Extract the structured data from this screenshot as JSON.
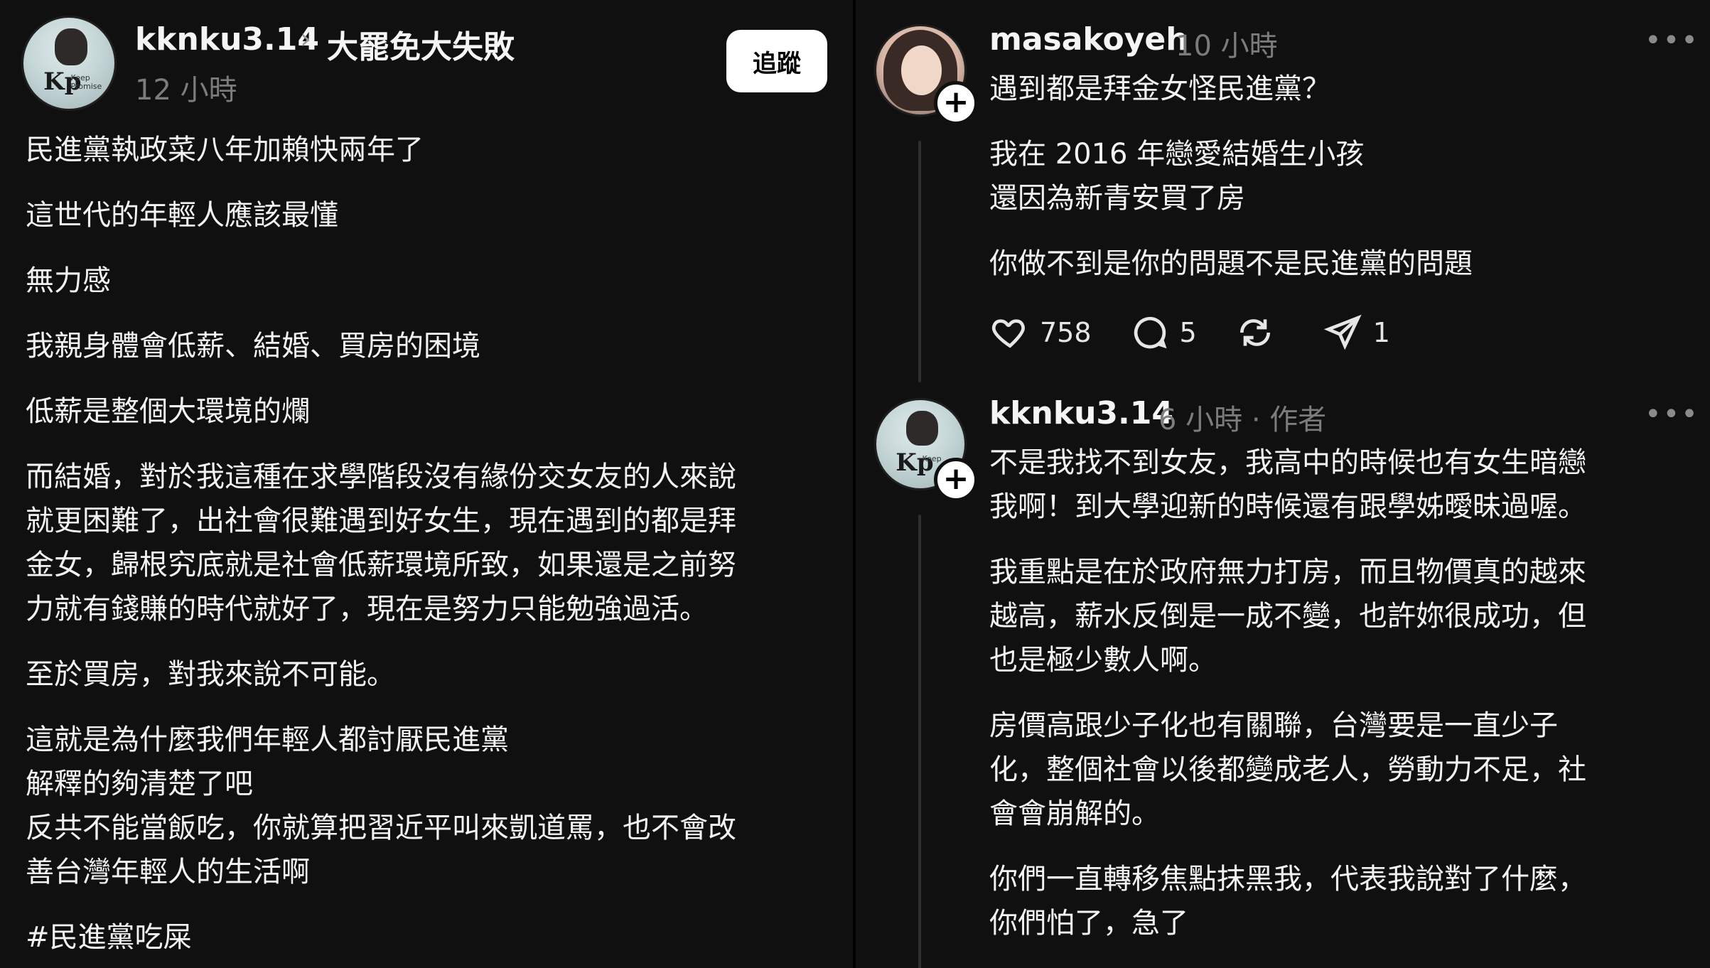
{
  "left_post": {
    "username": "kknku3.14",
    "separator": "›",
    "topic": "大罷免大失敗",
    "time": "12 小時",
    "follow_label": "追蹤",
    "avatar_logo": "Kp",
    "avatar_logo_sub": "Keep Promise",
    "paragraphs": [
      [
        "民進黨執政菜八年加賴快兩年了"
      ],
      [
        "這世代的年輕人應該最懂"
      ],
      [
        "無力感"
      ],
      [
        "我親身體會低薪、結婚、買房的困境"
      ],
      [
        "低薪是整個大環境的爛"
      ],
      [
        "而結婚，對於我這種在求學階段沒有緣份交女友的人來說",
        "就更困難了，出社會很難遇到好女生，現在遇到的都是拜",
        "金女，歸根究底就是社會低薪環境所致，如果還是之前努",
        "力就有錢賺的時代就好了，現在是努力只能勉強過活。"
      ],
      [
        "至於買房，對我來說不可能。"
      ],
      [
        "這就是為什麼我們年輕人都討厭民進黨",
        "解釋的夠清楚了吧",
        "反共不能當飯吃，你就算把習近平叫來凱道罵，也不會改",
        "善台灣年輕人的生活啊"
      ],
      [
        "#民進黨吃屎"
      ]
    ]
  },
  "reply1": {
    "username": "masakoyeh",
    "time": "10 小時",
    "more": "•••",
    "lines": [
      "遇到都是拜金女怪民進黨？",
      "我在 2016 年戀愛結婚生小孩",
      "還因為新青安買了房",
      "你做不到是你的問題不是民進黨的問題"
    ],
    "likes": "758",
    "comments": "5",
    "shares": "1",
    "icons": [
      "heart-icon",
      "comment-icon",
      "repost-icon",
      "share-icon"
    ]
  },
  "reply2": {
    "username": "kknku3.14",
    "time": "6 小時 · 作者",
    "more": "•••",
    "avatar_logo": "Kp",
    "avatar_logo_sub": "Keep",
    "paragraphs": [
      [
        "不是我找不到女友，我高中的時候也有女生暗戀",
        "我啊！到大學迎新的時候還有跟學姊曖昧過喔。"
      ],
      [
        "我重點是在於政府無力打房，而且物價真的越來",
        "越高，薪水反倒是一成不變，也許妳很成功，但",
        "也是極少數人啊。"
      ],
      [
        "房價高跟少子化也有關聯，台灣要是一直少子",
        "化，整個社會以後都變成老人，勞動力不足，社",
        "會會崩解的。"
      ],
      [
        "你們一直轉移焦點抹黑我，代表我說對了什麼，",
        "你們怕了，急了"
      ]
    ]
  },
  "colors": {
    "background": "#101010",
    "text": "#f3f3f3",
    "muted": "#7c7c7c",
    "button_bg": "#ffffff"
  }
}
